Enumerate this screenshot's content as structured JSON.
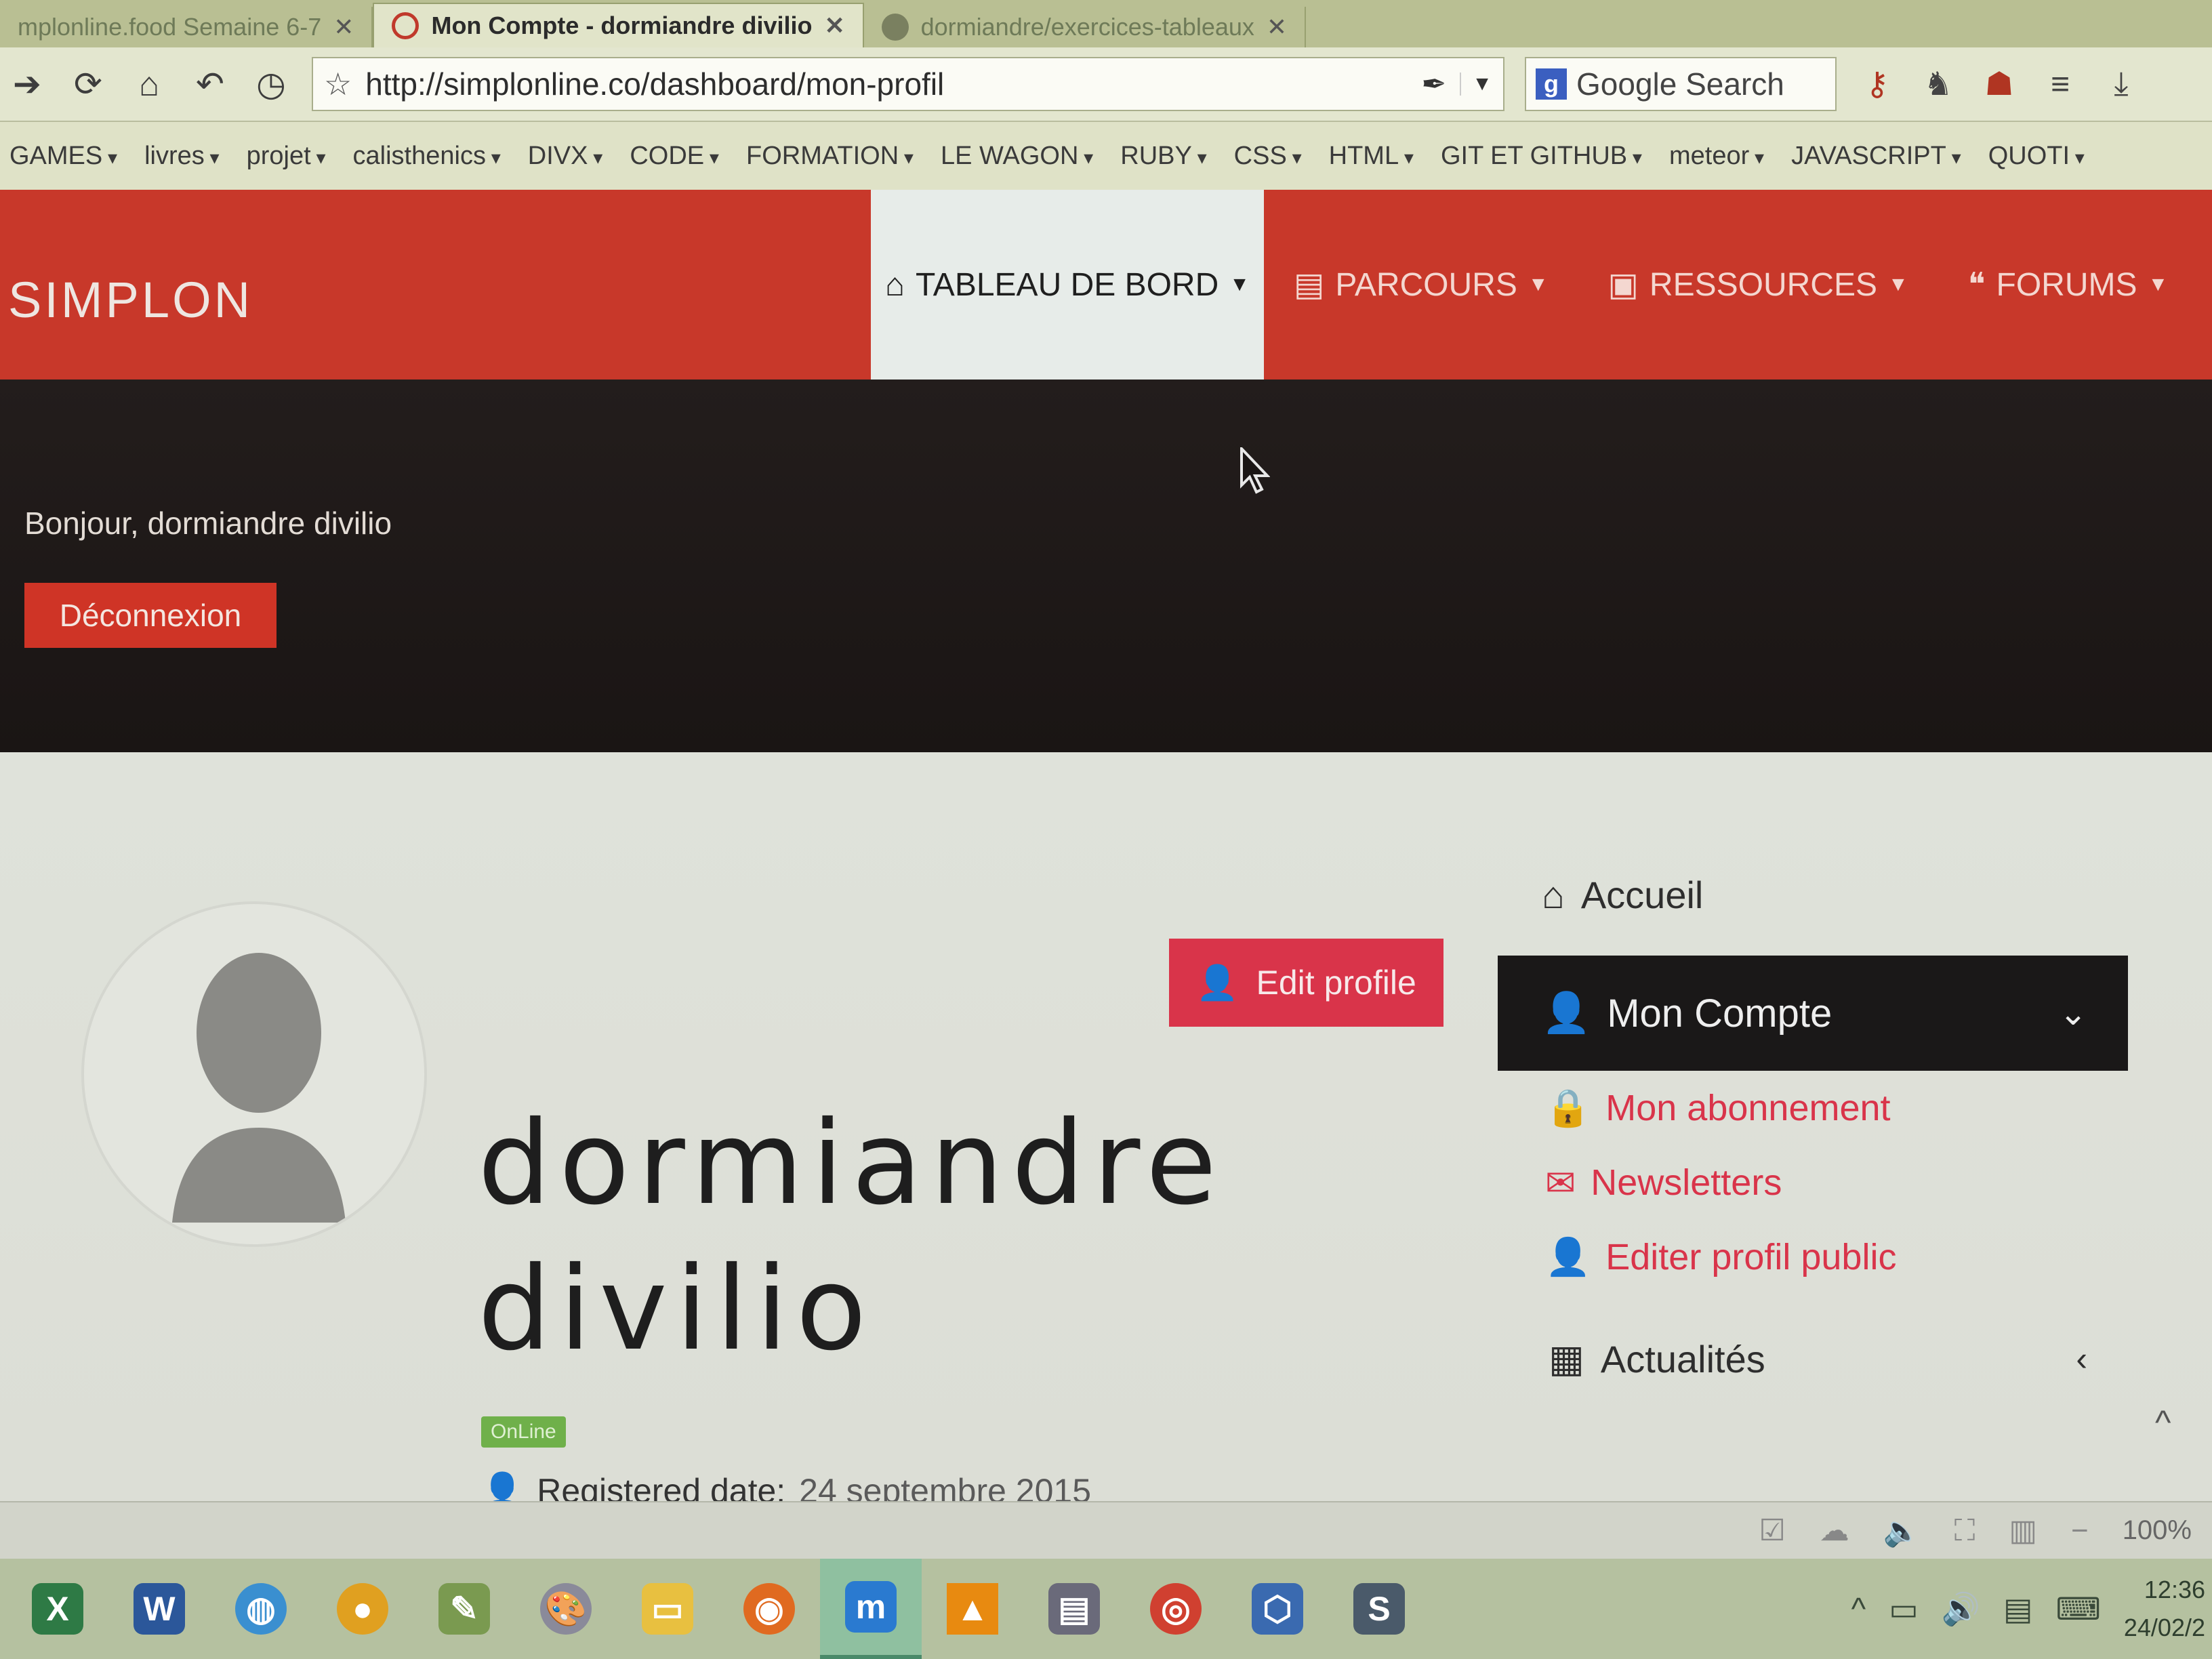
{
  "browser": {
    "tabs": [
      {
        "label": "mplonline.food Semaine 6-7",
        "active": false
      },
      {
        "label": "Mon Compte - dormiandre divilio",
        "active": true
      },
      {
        "label": "dormiandre/exercices-tableaux",
        "active": false
      }
    ],
    "url": "http://simplonline.co/dashboard/mon-profil",
    "search_placeholder": "Google Search",
    "bookmarks": [
      "GAMES",
      "livres",
      "projet",
      "calisthenics",
      "DIVX",
      "CODE",
      "FORMATION",
      "LE WAGON",
      "RUBY",
      "CSS",
      "HTML",
      "GIT ET GITHUB",
      "meteor",
      "JAVASCRIPT",
      "QUOTI"
    ]
  },
  "site": {
    "logo": "SIMPLON",
    "nav": [
      {
        "label": "TABLEAU DE BORD",
        "icon": "home-icon",
        "active": true
      },
      {
        "label": "PARCOURS",
        "icon": "book-icon",
        "active": false
      },
      {
        "label": "RESSOURCES",
        "icon": "folder-icon",
        "active": false
      },
      {
        "label": "FORUMS",
        "icon": "comments-icon",
        "active": false
      }
    ]
  },
  "banner": {
    "greeting": "Bonjour, dormiandre divilio",
    "logout_label": "Déconnexion"
  },
  "profile": {
    "first_name": "dormiandre",
    "last_name": "divilio",
    "edit_label": "Edit profile",
    "status_badge": "OnLine",
    "registered_label": "Registered date:",
    "registered_value": "24 septembre 2015"
  },
  "sidemenu": {
    "home": "Accueil",
    "account": "Mon Compte",
    "subitems": [
      "Mon abonnement",
      "Newsletters",
      "Editer profil public"
    ],
    "news": "Actualités"
  },
  "statusbar": {
    "zoom": "100%"
  },
  "taskbar": {
    "time": "12:36",
    "date": "24/02/2"
  },
  "colors": {
    "brand_red": "#c8382a",
    "accent_pink": "#d9344a",
    "online_green": "#6fb04a"
  }
}
